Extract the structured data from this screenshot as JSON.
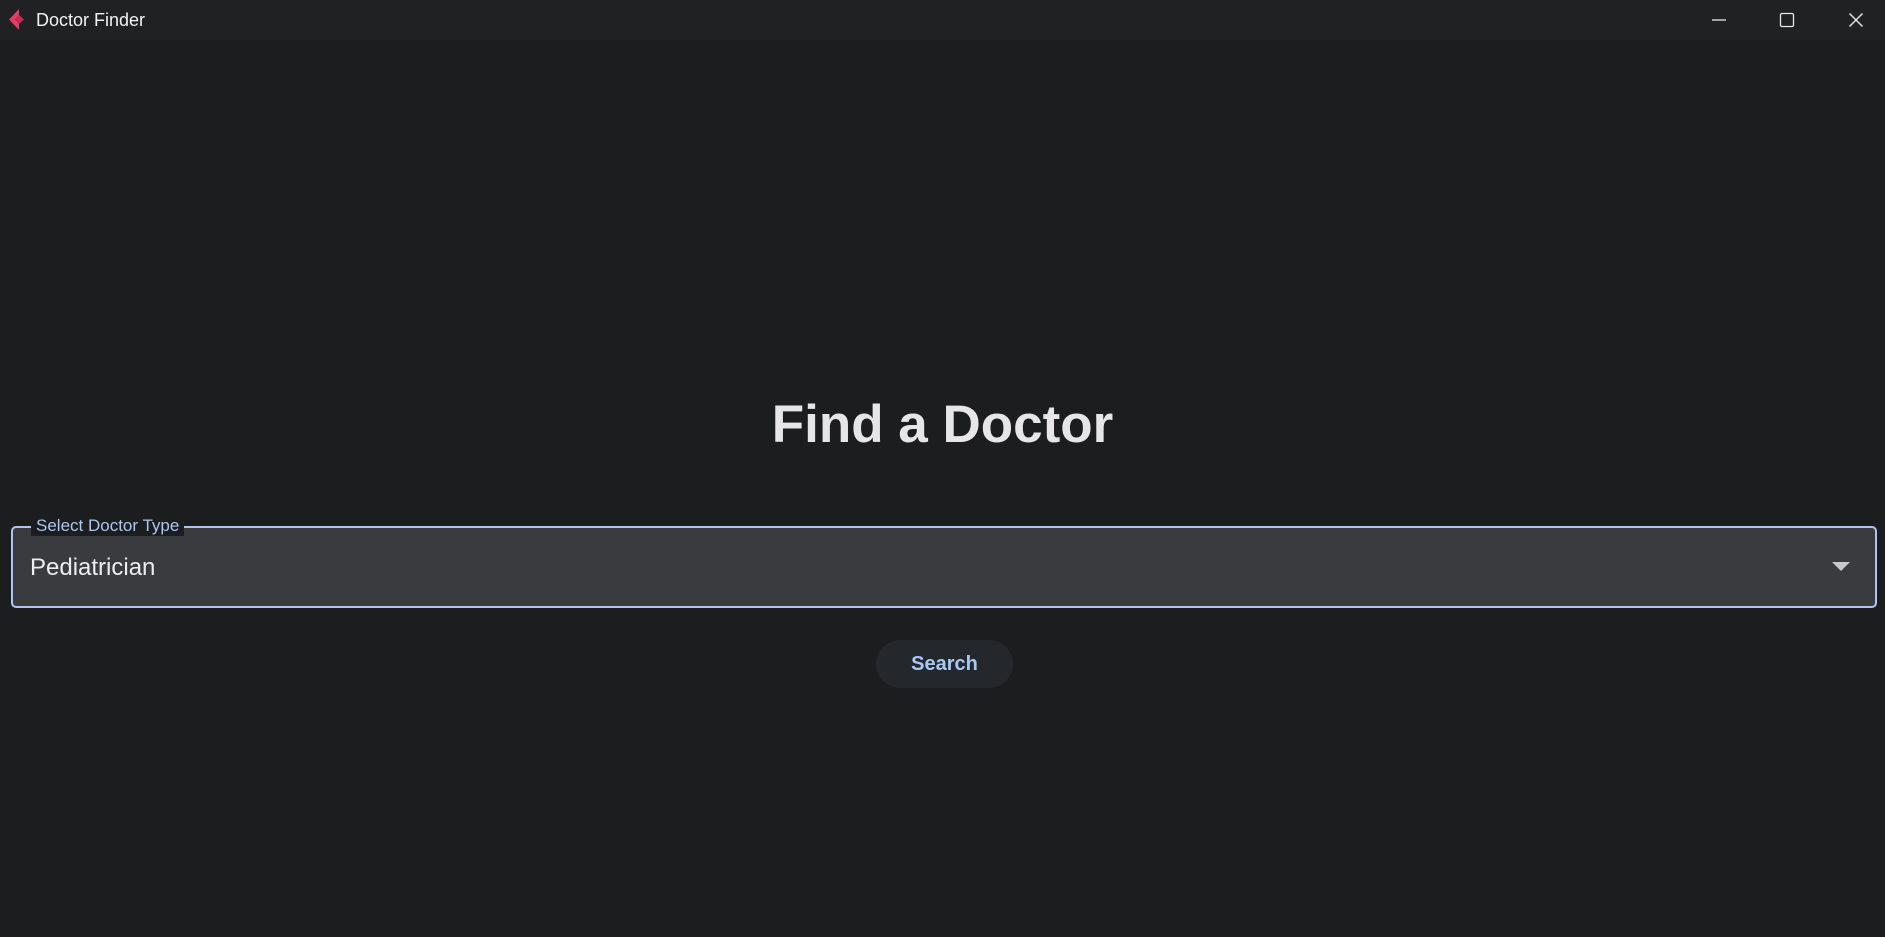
{
  "window": {
    "title": "Doctor Finder",
    "icons": {
      "app": "app-logo-icon",
      "minimize": "minimize-icon",
      "maximize": "maximize-icon",
      "close": "close-icon"
    }
  },
  "main": {
    "heading": "Find a Doctor",
    "doctor_type_select": {
      "label": "Select Doctor Type",
      "selected_value": "Pediatrician",
      "icon": "chevron-down-icon"
    },
    "search_button": {
      "label": "Search"
    }
  },
  "colors": {
    "background": "#1c1d1f",
    "titlebar": "#1f2123",
    "accent": "#a9c7f2",
    "field_background": "#3a3b3e",
    "button_background": "#24272c"
  }
}
